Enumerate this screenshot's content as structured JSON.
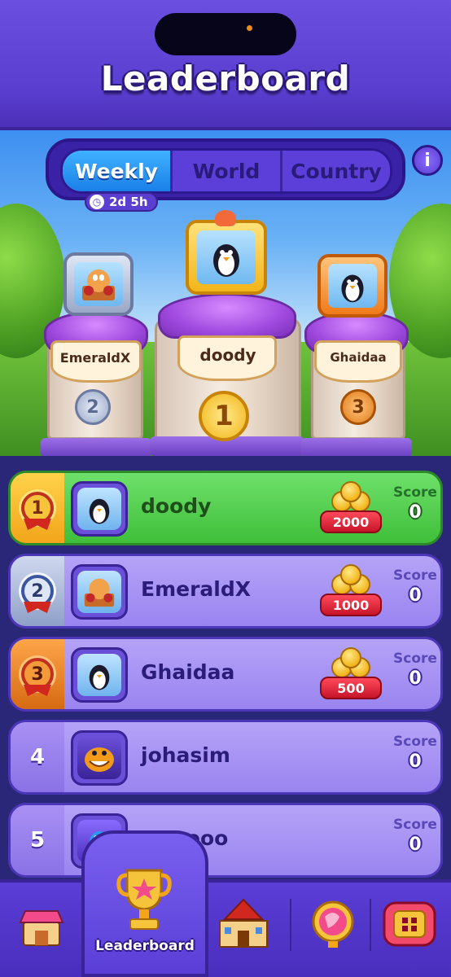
{
  "header": {
    "title": "Leaderboard"
  },
  "tabs": [
    {
      "label": "Weekly",
      "active": true
    },
    {
      "label": "World",
      "active": false
    },
    {
      "label": "Country",
      "active": false
    }
  ],
  "timer": "2d 5h",
  "info_label": "i",
  "podium": [
    {
      "position": 2,
      "name": "EmeraldX",
      "medal": "2"
    },
    {
      "position": 1,
      "name": "doody",
      "medal": "1"
    },
    {
      "position": 3,
      "name": "Ghaidaa",
      "medal": "3"
    }
  ],
  "score_label": "Score",
  "rows": [
    {
      "rank": "1",
      "name": "doody",
      "reward": "2000",
      "score": "0"
    },
    {
      "rank": "2",
      "name": "EmeraldX",
      "reward": "1000",
      "score": "0"
    },
    {
      "rank": "3",
      "name": "Ghaidaa",
      "reward": "500",
      "score": "0"
    },
    {
      "rank": "4",
      "name": "johasim",
      "score": "0"
    },
    {
      "rank": "5",
      "name": "Negooo",
      "score": "0"
    }
  ],
  "nav": {
    "active_label": "Leaderboard",
    "items": [
      "shop-icon",
      "trophy-icon",
      "castle-icon",
      "globe-icon",
      "menu-icon"
    ]
  },
  "colors": {
    "header": "#5a3ed0",
    "active_tab": "#1a7fe8",
    "first_row": "#3fbf3a",
    "row": "#9a84f0",
    "reward_badge": "#c8142a"
  }
}
